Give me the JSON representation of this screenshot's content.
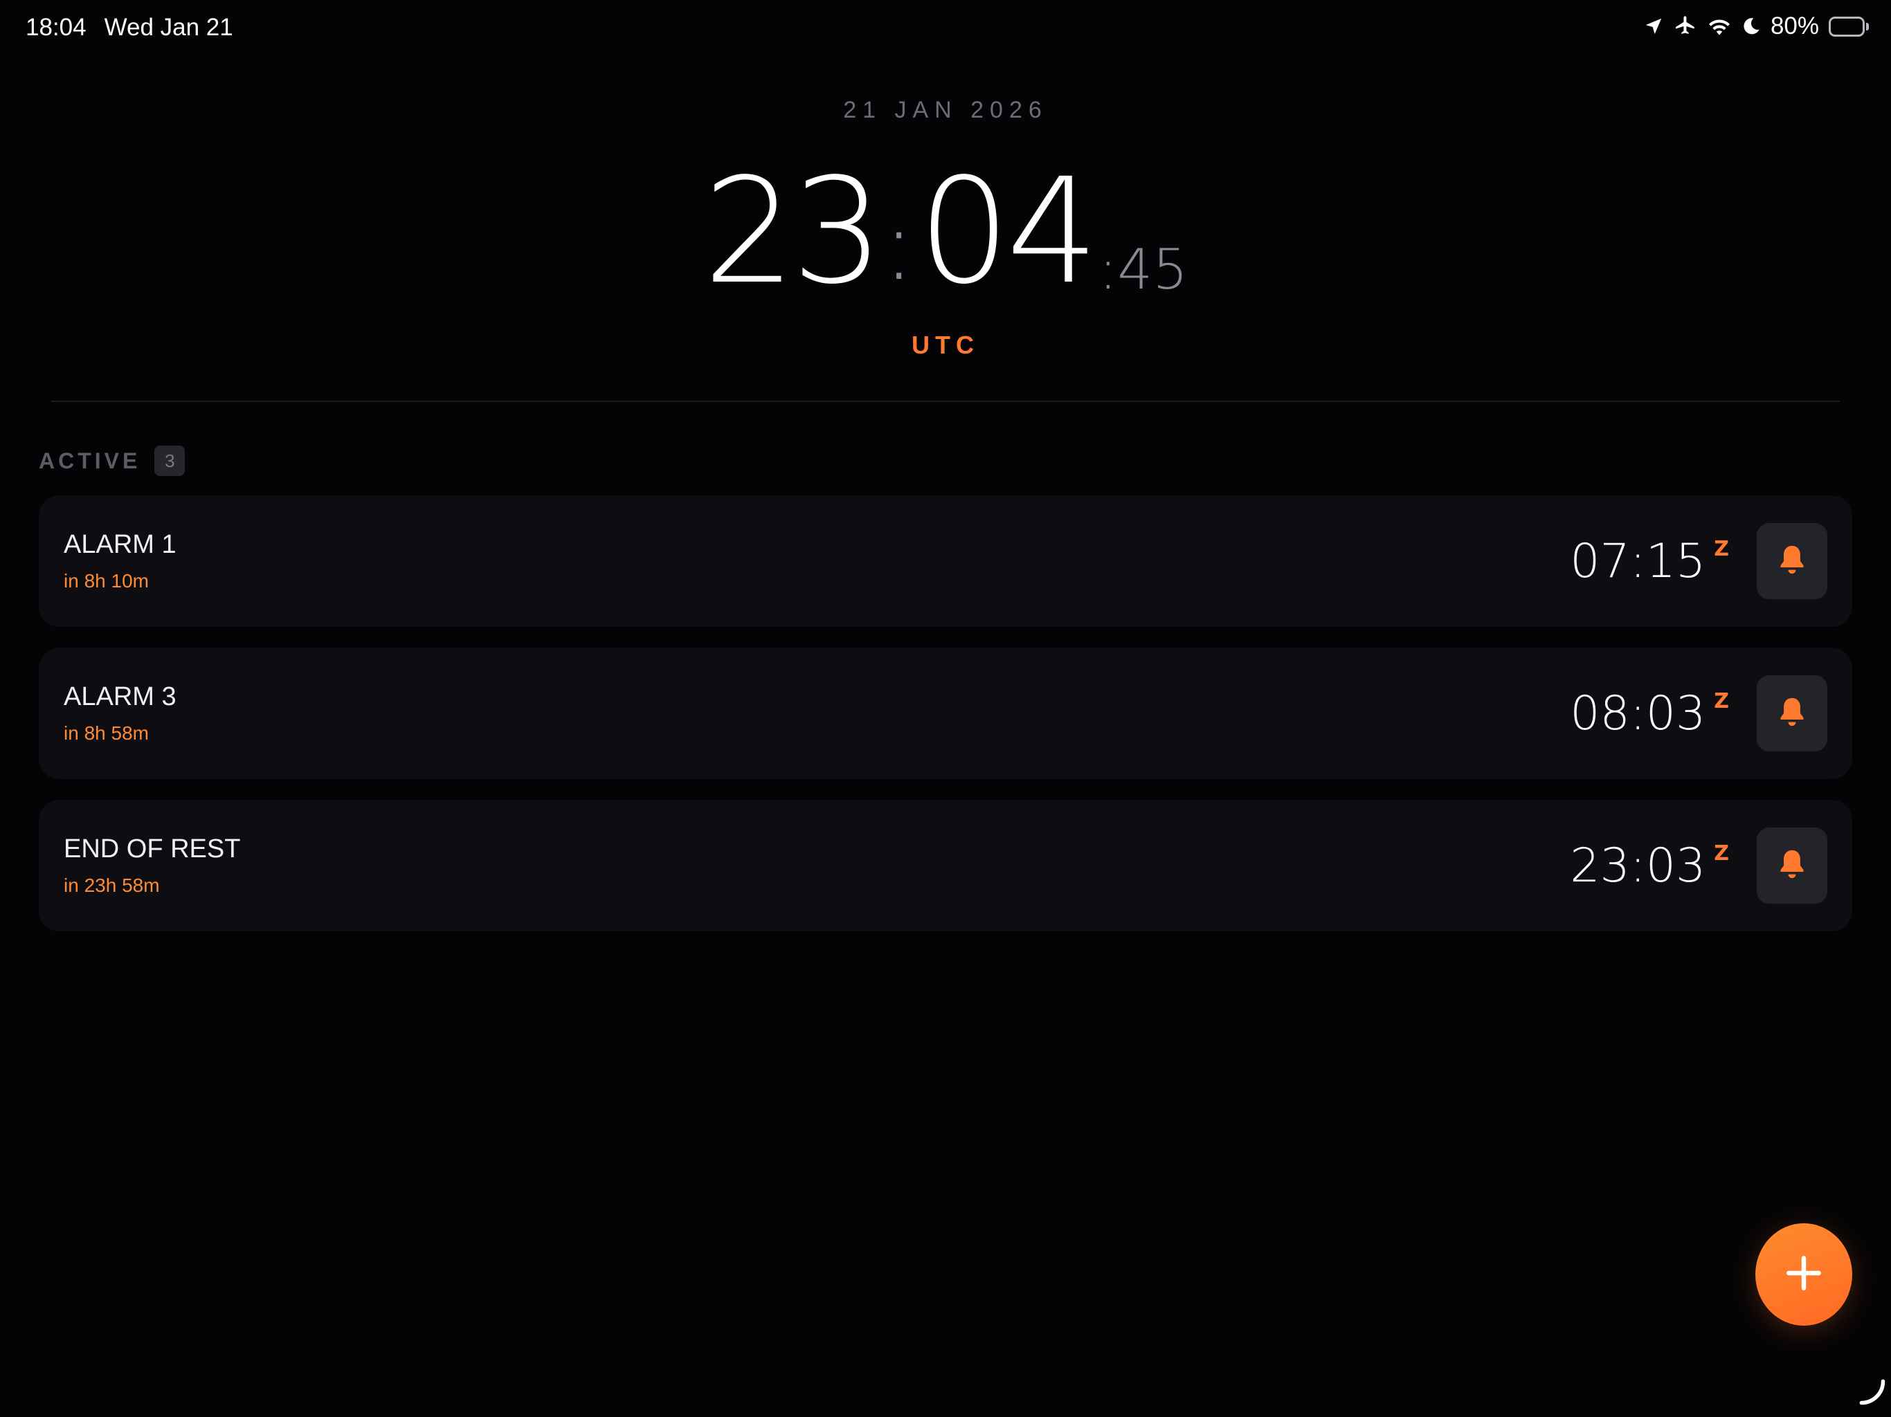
{
  "status_bar": {
    "time": "18:04",
    "date": "Wed Jan 21",
    "battery_percent": "80%",
    "battery_level": 0.8,
    "icons": [
      "location-arrow-icon",
      "airplane-icon",
      "wifi-icon",
      "moon-icon",
      "battery-icon"
    ]
  },
  "clock": {
    "date": "21 JAN 2026",
    "hours": "23",
    "minutes": "04",
    "seconds": "45",
    "separator": ":",
    "timezone": "UTC"
  },
  "section": {
    "title": "ACTIVE",
    "count": "3"
  },
  "alarms": [
    {
      "name": "ALARM 1",
      "countdown": "in 8h 10m",
      "time": "07:15",
      "zone": "Z",
      "icon": "bell-icon"
    },
    {
      "name": "ALARM 3",
      "countdown": "in 8h 58m",
      "time": "08:03",
      "zone": "Z",
      "icon": "bell-icon"
    },
    {
      "name": "END OF REST",
      "countdown": "in 23h 58m",
      "time": "23:03",
      "zone": "Z",
      "icon": "bell-icon"
    }
  ],
  "fab": {
    "icon": "plus-icon"
  },
  "colors": {
    "accent": "#ff7a2e",
    "background": "#040406",
    "card": "#0e0e12",
    "muted": "#6c6c74"
  }
}
